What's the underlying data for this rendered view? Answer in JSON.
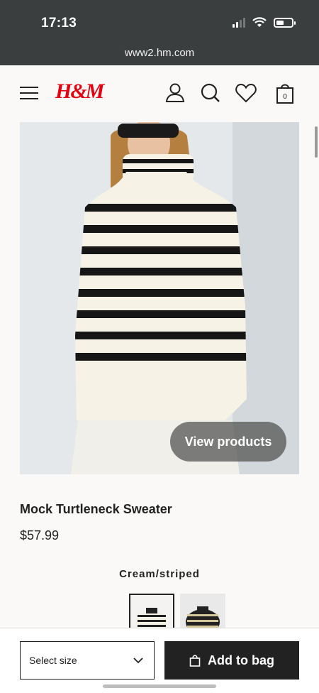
{
  "status_bar": {
    "time": "17:13"
  },
  "browser": {
    "url": "www2.hm.com"
  },
  "header": {
    "brand": "H&M",
    "brand_color": "#e50010",
    "icons": [
      "menu-icon",
      "user-icon",
      "search-icon",
      "heart-icon",
      "bag-icon"
    ],
    "cart_count": "0"
  },
  "hero": {
    "view_products_label": "View products"
  },
  "product": {
    "title": "Mock Turtleneck Sweater",
    "price": "$57.99",
    "color_name": "Cream/striped"
  },
  "purchase": {
    "size_placeholder": "Select size",
    "add_to_bag_label": "Add to bag"
  }
}
